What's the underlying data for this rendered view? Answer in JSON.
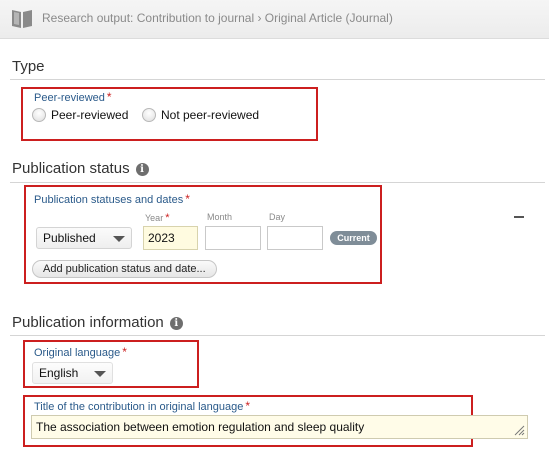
{
  "header": {
    "breadcrumb": "Research output: Contribution to journal › Original Article (Journal)"
  },
  "type_section": {
    "title": "Type",
    "peer_reviewed_label": "Peer-reviewed",
    "required_mark": "*",
    "options": [
      "Peer-reviewed",
      "Not peer-reviewed"
    ]
  },
  "status_section": {
    "title": "Publication status",
    "field_label": "Publication statuses and dates",
    "required_mark": "*",
    "status_value": "Published",
    "year_label": "Year",
    "month_label": "Month",
    "day_label": "Day",
    "year_value": "2023",
    "month_value": "",
    "day_value": "",
    "current_badge": "Current",
    "add_button": "Add publication status and date..."
  },
  "info_section": {
    "title": "Publication information",
    "language_label": "Original language",
    "required_mark": "*",
    "language_value": "English",
    "title_label": "Title of the contribution in original language",
    "title_value": "The association between emotion regulation and sleep quality"
  },
  "icons": {
    "info": "info-icon",
    "book": "book-icon"
  },
  "colors": {
    "highlight_box": "#cc1f1f",
    "label_blue": "#2a5a8a",
    "required_red": "#cc2222",
    "current_badge": "#7f8d98"
  }
}
